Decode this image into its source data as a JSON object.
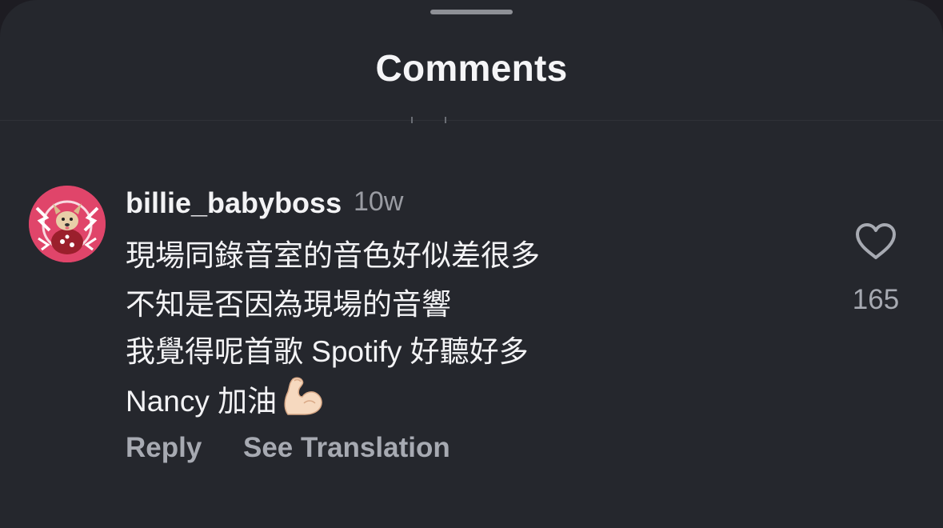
{
  "sheet": {
    "title": "Comments"
  },
  "comment": {
    "username": "billie_babyboss",
    "time": "10w",
    "lines": [
      "現場同錄音室的音色好似差很多",
      "不知是否因為現場的音響",
      "我覺得呢首歌 Spotify 好聽好多",
      "Nancy 加油"
    ],
    "emoji": "flexed-biceps-icon",
    "actions": {
      "reply": "Reply",
      "translate": "See Translation"
    },
    "likes": "165"
  },
  "colors": {
    "background": "#25272d",
    "text": "#f3f3f5",
    "muted": "#a7aab2",
    "avatar_ring": "#e0456a"
  }
}
